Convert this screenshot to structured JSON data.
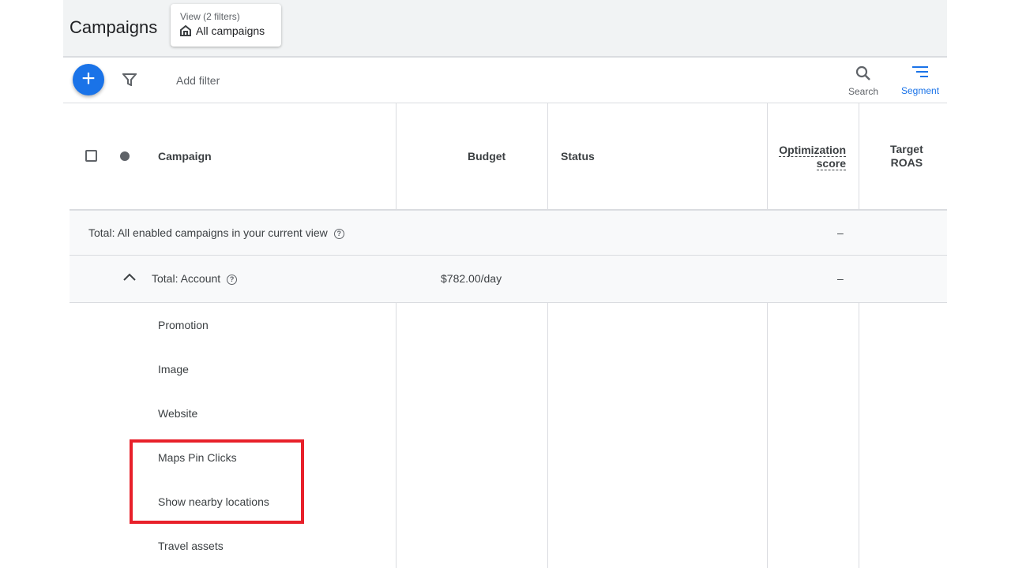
{
  "header": {
    "title": "Campaigns",
    "view_label": "View (2 filters)",
    "view_value": "All campaigns"
  },
  "toolbar": {
    "add_filter": "Add filter",
    "search": "Search",
    "segment": "Segment"
  },
  "columns": [
    "Campaign",
    "Budget",
    "Status",
    "Optimization score",
    "Target ROAS"
  ],
  "columns_split": {
    "opt1": "Optimization",
    "opt2": "score",
    "roas1": "Target",
    "roas2": "ROAS"
  },
  "total_all": {
    "label": "Total: All enabled campaigns in your current view",
    "opt": "–"
  },
  "total_account": {
    "label": "Total: Account",
    "budget": "$782.00/day",
    "opt": "–"
  },
  "rows": [
    "Promotion",
    "Image",
    "Website",
    "Maps Pin Clicks",
    "Show nearby locations",
    "Travel assets"
  ],
  "colors": {
    "accent": "#1a73e8",
    "highlight": "#e8202a"
  }
}
